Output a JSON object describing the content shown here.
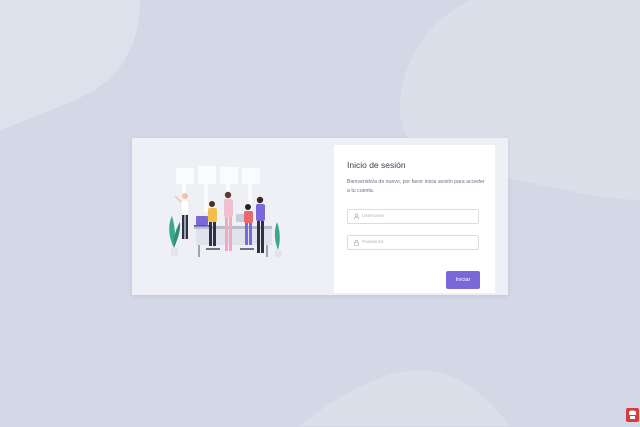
{
  "login": {
    "title": "Inicio de sesión",
    "subtitle": "Bienvenido/a de nuevo, por favor inicia sesión para acceder a tu cuenta.",
    "username_placeholder": "Username",
    "password_placeholder": "Password",
    "submit_label": "Iniciar"
  },
  "icons": {
    "username": "user-icon",
    "password": "lock-icon",
    "corner": "brand-logo-icon"
  },
  "colors": {
    "background": "#d3d7e6",
    "card": "#eef0f6",
    "panel": "#ffffff",
    "accent": "#7a68d8",
    "brand": "#d83b3b"
  }
}
